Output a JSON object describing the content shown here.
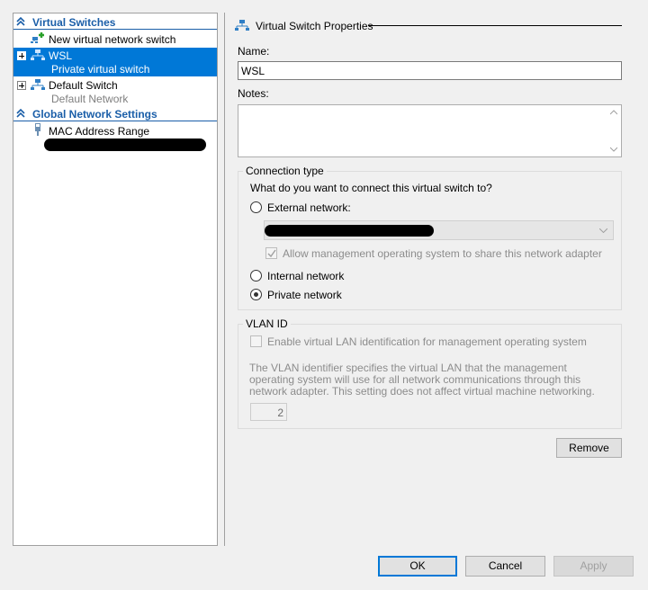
{
  "sidebar": {
    "virtual_switches_header": "Virtual Switches",
    "new_switch": "New virtual network switch",
    "items": [
      {
        "name": "WSL",
        "type": "Private virtual switch",
        "selected": true
      },
      {
        "name": "Default Switch",
        "type": "Default Network",
        "selected": false
      }
    ],
    "global_header": "Global Network Settings",
    "mac_range": "MAC Address Range"
  },
  "props": {
    "section_title": "Virtual Switch Properties",
    "name_label": "Name:",
    "name_value": "WSL",
    "notes_label": "Notes:",
    "notes_value": "",
    "connection_type": "Connection type",
    "connect_question": "What do you want to connect this virtual switch to?",
    "external_network": "External network:",
    "allow_mgmt": "Allow management operating system to share this network adapter",
    "internal_network": "Internal network",
    "private_network": "Private network",
    "selected_connection": "Private network",
    "vlan_title": "VLAN ID",
    "vlan_enable": "Enable virtual LAN identification for management operating system",
    "vlan_desc": "The VLAN identifier specifies the virtual LAN that the management operating system will use for all network communications through this network adapter. This setting does not affect virtual machine networking.",
    "vlan_value": "2",
    "remove": "Remove"
  },
  "footer": {
    "ok": "OK",
    "cancel": "Cancel",
    "apply": "Apply"
  },
  "colors": {
    "accent": "#0078d7",
    "header_blue": "#1a5ea8",
    "switch_icon": "#2f7fc6",
    "add_green": "#2aa02a"
  }
}
